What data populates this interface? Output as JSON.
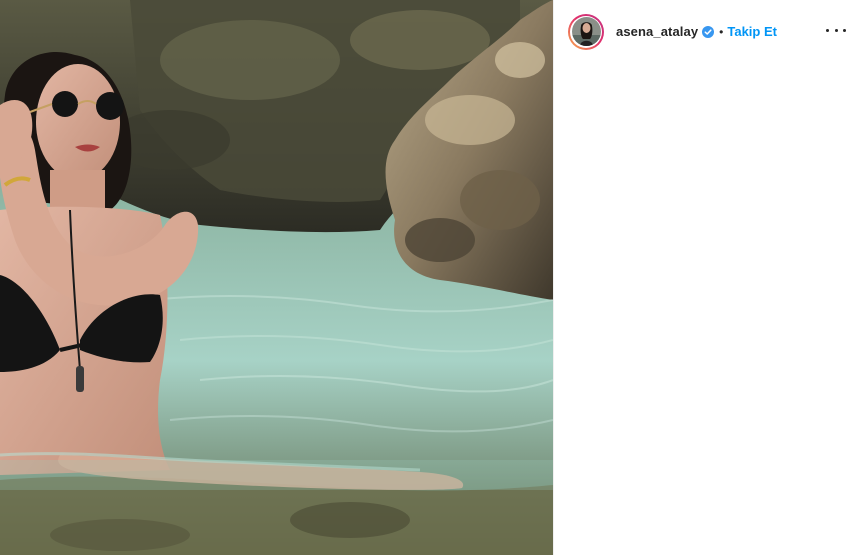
{
  "post": {
    "image": {
      "alt_icon": "photo-icon"
    },
    "author": {
      "username": "asena_atalay",
      "verified": true,
      "separator": "•",
      "follow_label": "Takip Et",
      "more_icon": "more-options-icon"
    },
    "colors": {
      "follow_blue": "#0095f6",
      "verified_blue": "#3897f0",
      "text_dark": "#262626",
      "story_ring_start": "#f9b14a",
      "story_ring_end": "#c13584"
    }
  }
}
